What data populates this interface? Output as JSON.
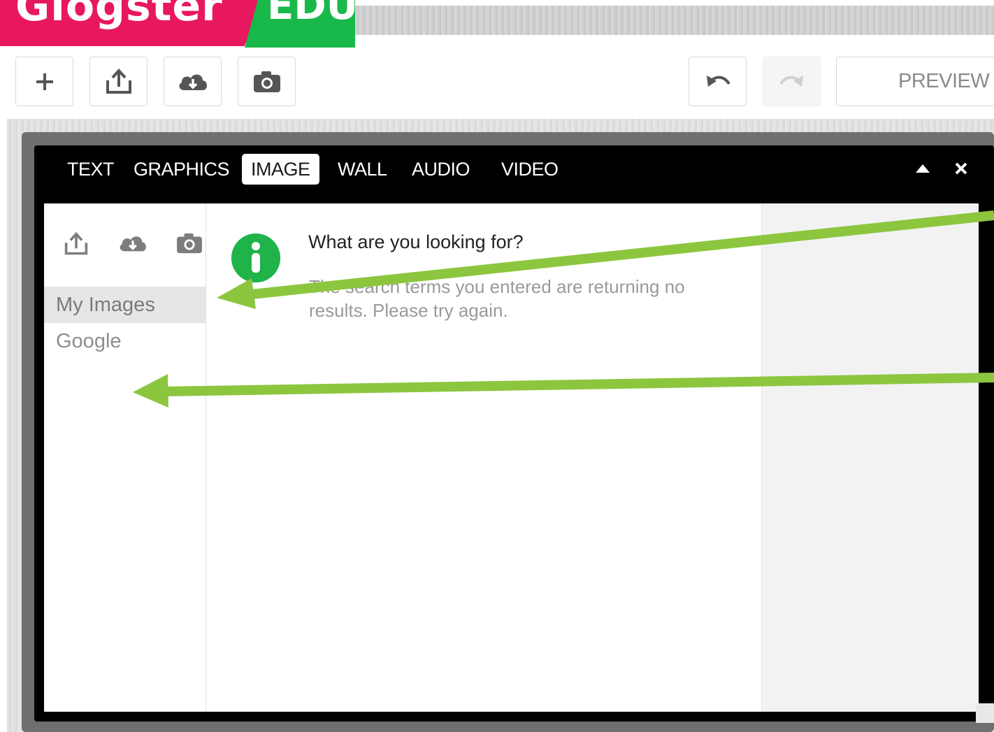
{
  "logo": {
    "brand": "Glogster",
    "tag": "EDU"
  },
  "toolbar": {
    "add_icon": "plus-icon",
    "upload_icon": "upload-icon",
    "cloud_icon": "cloud-download-icon",
    "camera_icon": "camera-icon",
    "undo_icon": "undo-icon",
    "redo_icon": "redo-icon",
    "preview_label": "PREVIEW"
  },
  "panel": {
    "tabs": [
      {
        "label": "TEXT"
      },
      {
        "label": "GRAPHICS"
      },
      {
        "label": "IMAGE",
        "active": true
      },
      {
        "label": "WALL"
      },
      {
        "label": "AUDIO"
      },
      {
        "label": "VIDEO"
      }
    ],
    "collapse_icon": "triangle-up-icon",
    "close_icon": "close-icon"
  },
  "sidebar": {
    "icons": [
      "upload-icon",
      "cloud-download-icon",
      "camera-icon"
    ],
    "items": [
      {
        "label": "My Images",
        "selected": true
      },
      {
        "label": "Google",
        "selected": false
      }
    ]
  },
  "message": {
    "icon": "info-icon",
    "title": "What are you looking for?",
    "body": "The search terms you entered are returning no results. Please try again."
  },
  "colors": {
    "brand_pink": "#e8185f",
    "brand_green": "#19b84a",
    "info_green": "#1fb34a",
    "annotation_arrow": "#8cc63f"
  }
}
